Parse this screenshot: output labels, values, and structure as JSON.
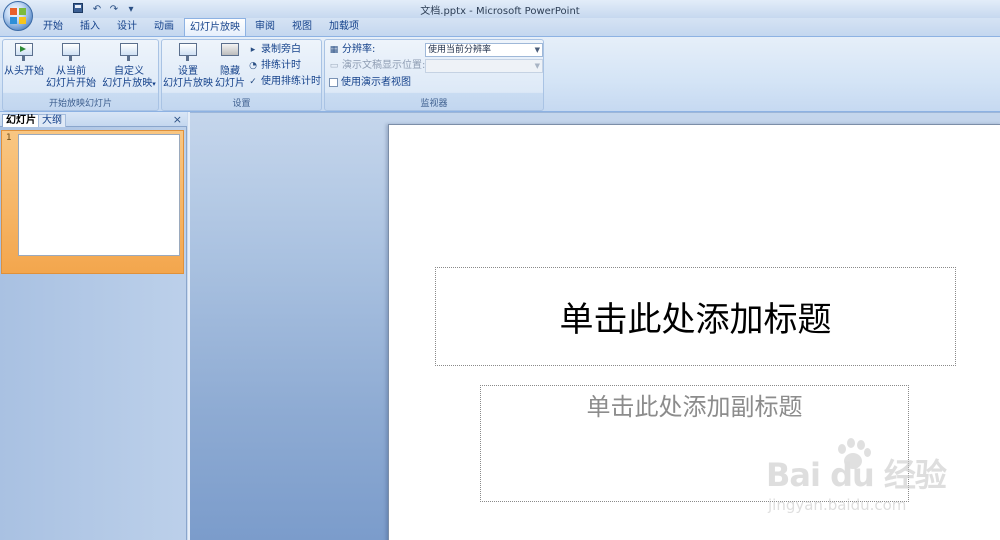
{
  "window": {
    "title": "文档.pptx - Microsoft PowerPoint"
  },
  "quick_access": {
    "save": "save-icon",
    "undo": "↶",
    "redo": "↷",
    "customize": "▾"
  },
  "tabs": [
    {
      "label": "开始",
      "active": false
    },
    {
      "label": "插入",
      "active": false
    },
    {
      "label": "设计",
      "active": false
    },
    {
      "label": "动画",
      "active": false
    },
    {
      "label": "幻灯片放映",
      "active": true
    },
    {
      "label": "审阅",
      "active": false
    },
    {
      "label": "视图",
      "active": false
    },
    {
      "label": "加载项",
      "active": false
    }
  ],
  "ribbon": {
    "start_group": {
      "label": "开始放映幻灯片",
      "from_beginning": "从头开始",
      "from_current_1": "从当前",
      "from_current_2": "幻灯片开始",
      "custom_1": "自定义",
      "custom_2": "幻灯片放映",
      "custom_arrow": "▾"
    },
    "setup_group": {
      "label": "设置",
      "setup_1": "设置",
      "setup_2": "幻灯片放映",
      "hide_1": "隐藏",
      "hide_2": "幻灯片",
      "record_narration": "录制旁白",
      "rehearse_timings": "排练计时",
      "use_timings": "使用排练计时",
      "use_timings_checked": "✓"
    },
    "monitors_group": {
      "label": "监视器",
      "resolution_label": "分辨率:",
      "resolution_value": "使用当前分辨率",
      "show_on_label": "演示文稿显示位置:",
      "show_on_value": "",
      "presenter_view": "使用演示者视图"
    }
  },
  "left_pane": {
    "tab_slides": "幻灯片",
    "tab_outline": "大纲",
    "close": "×",
    "slide_number": "1"
  },
  "slide": {
    "title_placeholder": "单击此处添加标题",
    "subtitle_placeholder": "单击此处添加副标题"
  },
  "watermark": {
    "brand": "Bai  du 经验",
    "url": "jingyan.baidu.com"
  }
}
